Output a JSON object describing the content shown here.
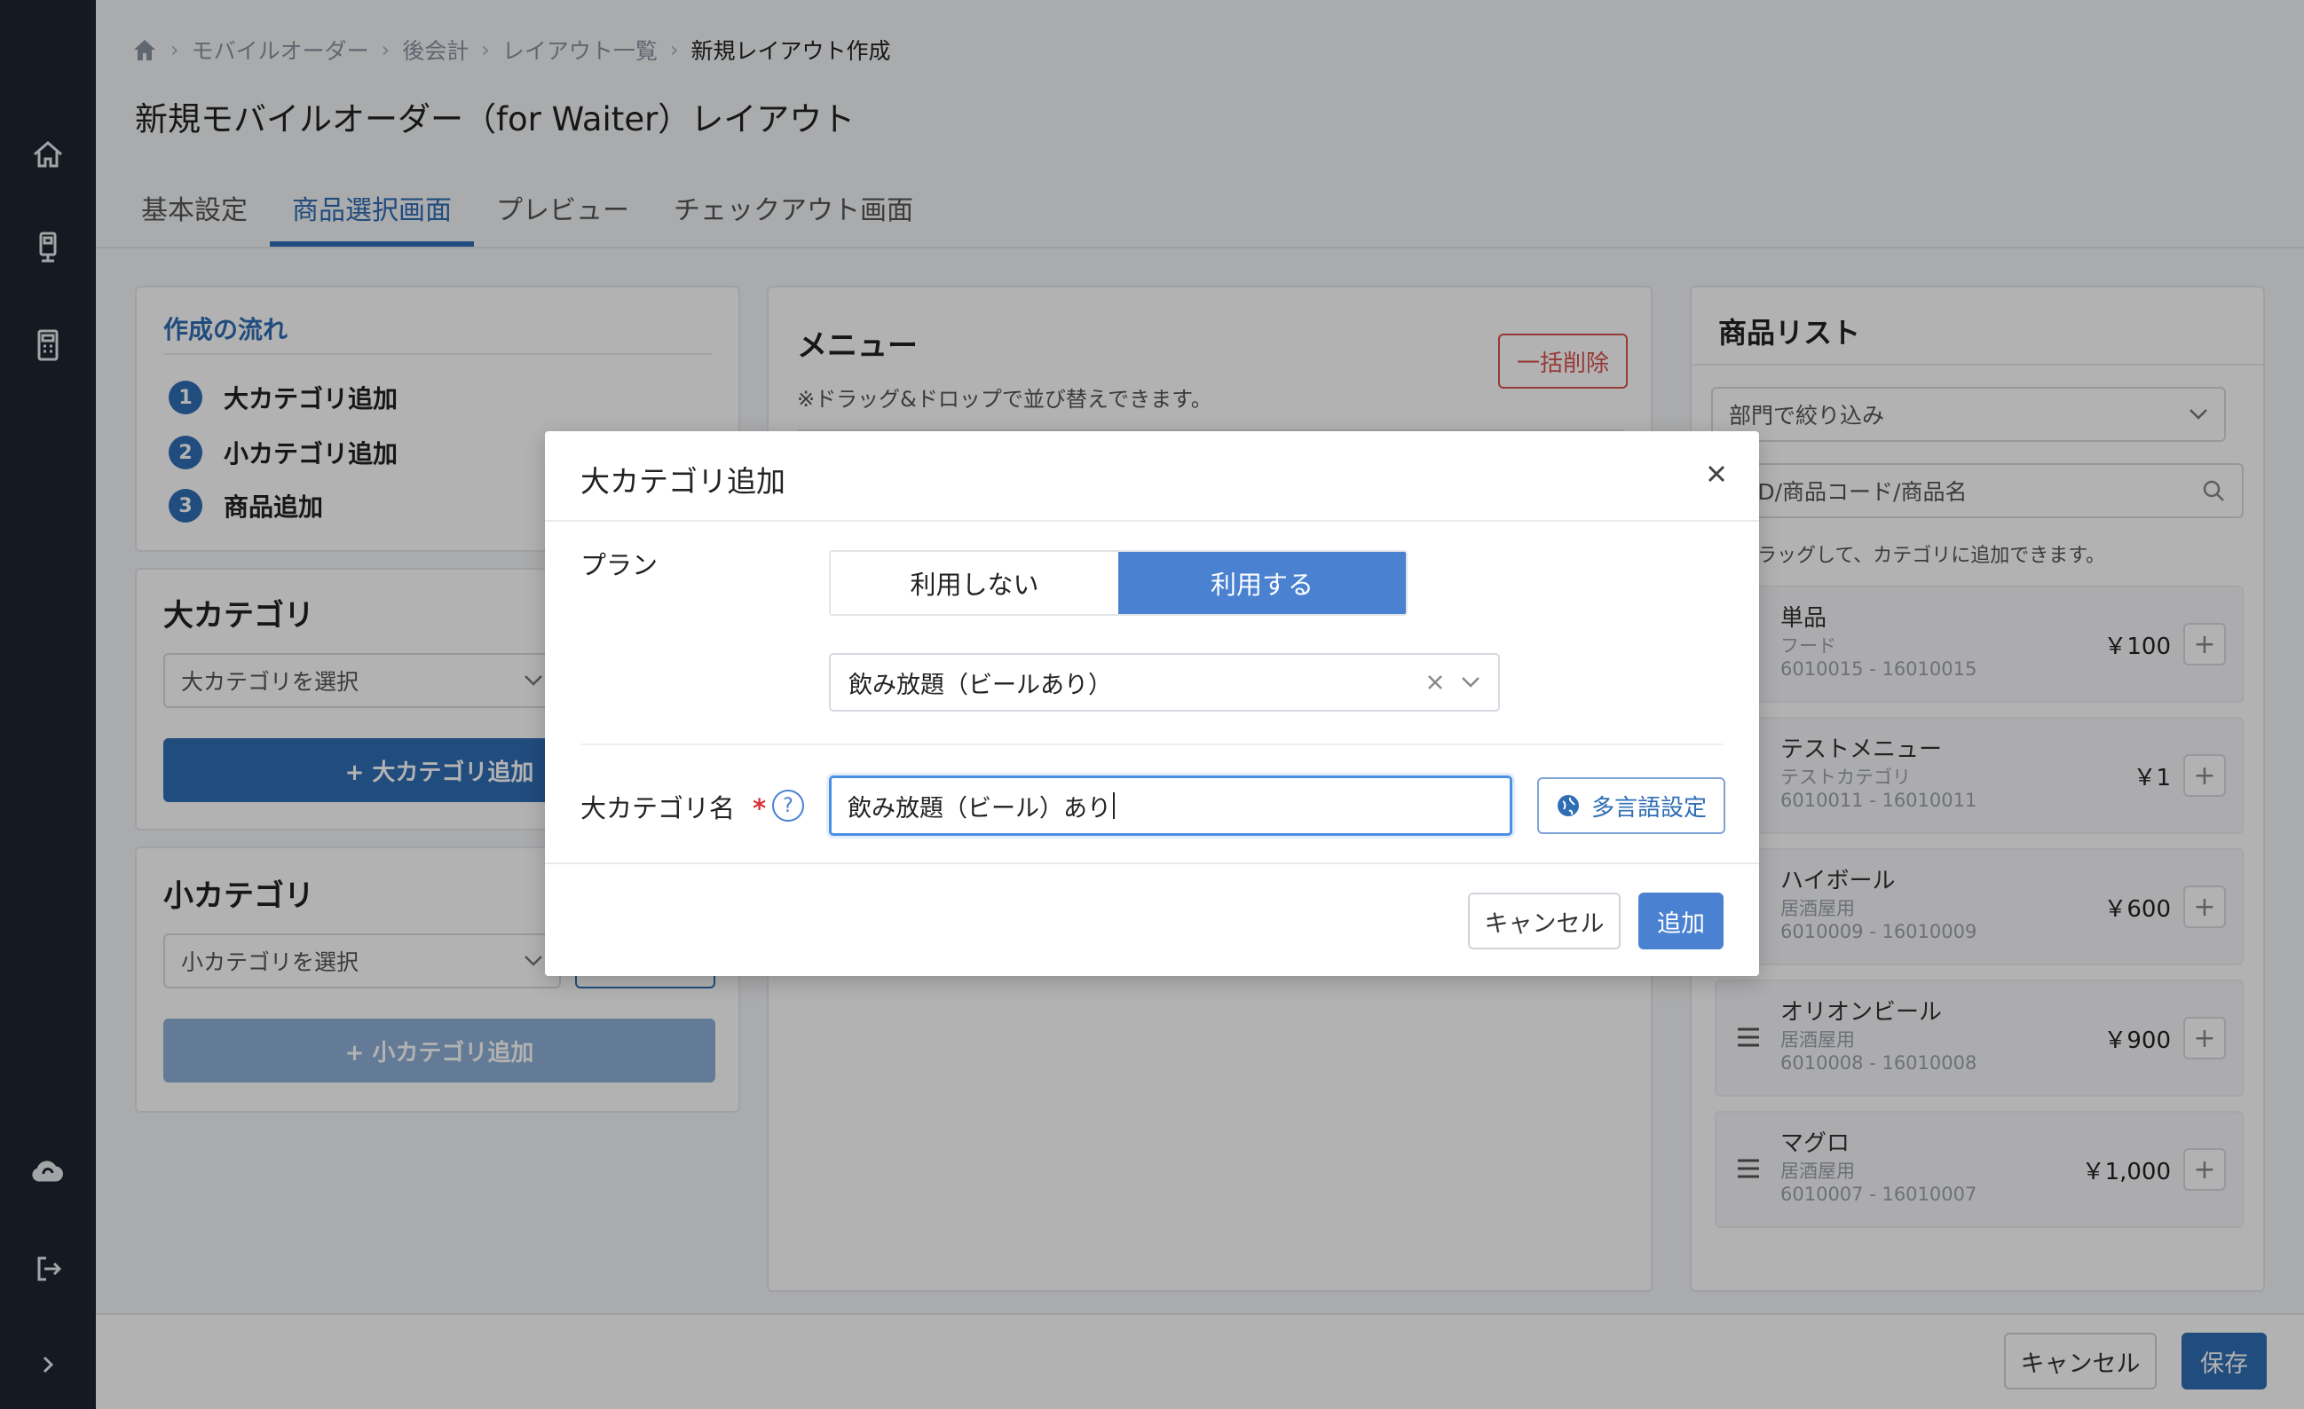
{
  "breadcrumb": [
    "モバイルオーダー",
    "後会計",
    "レイアウト一覧"
  ],
  "breadcrumb_current": "新規レイアウト作成",
  "page_title": "新規モバイルオーダー（for Waiter）レイアウト",
  "tabs": [
    "基本設定",
    "商品選択画面",
    "プレビュー",
    "チェックアウト画面"
  ],
  "flow": {
    "title": "作成の流れ",
    "steps": [
      {
        "num": "1",
        "label": "大カテゴリ追加"
      },
      {
        "num": "2",
        "label": "小カテゴリ追加"
      },
      {
        "num": "3",
        "label": "商品追加"
      }
    ]
  },
  "large_category": {
    "title": "大カテゴリ",
    "placeholder": "大カテゴリを選択",
    "add_button": "+ 大カテゴリ追加"
  },
  "small_category": {
    "title": "小カテゴリ",
    "placeholder": "小カテゴリを選択",
    "add_button": "+ 小カテゴリ追加"
  },
  "menu": {
    "title": "メニュー",
    "note": "※ドラッグ&ドロップで並び替えできます。",
    "bulk_delete": "一括削除"
  },
  "products": {
    "title": "商品リスト",
    "filter_placeholder": "部門で絞り込み",
    "search_placeholder": "品ID/商品コード/商品名",
    "note": "をドラッグして、カテゴリに追加できます。",
    "items": [
      {
        "name": "単品",
        "category": "フード",
        "code": "6010015 - 16010015",
        "price": "￥100"
      },
      {
        "name": "テストメニュー",
        "category": "テストカテゴリ",
        "code": "6010011 - 16010011",
        "price": "￥1"
      },
      {
        "name": "ハイボール",
        "category": "居酒屋用",
        "code": "6010009 - 16010009",
        "price": "￥600"
      },
      {
        "name": "オリオンビール",
        "category": "居酒屋用",
        "code": "6010008 - 16010008",
        "price": "￥900"
      },
      {
        "name": "マグロ",
        "category": "居酒屋用",
        "code": "6010007 - 16010007",
        "price": "￥1,000"
      }
    ]
  },
  "footer": {
    "cancel": "キャンセル",
    "save": "保存"
  },
  "modal": {
    "title": "大カテゴリ追加",
    "plan_label": "プラン",
    "plan_options": {
      "off": "利用しない",
      "on": "利用する"
    },
    "plan_selected": "飲み放題（ビールあり）",
    "name_label": "大カテゴリ名",
    "required_mark": "*",
    "help": "?",
    "name_value": "飲み放題（ビール）あり",
    "lang_button": "多言語設定",
    "cancel": "キャンセル",
    "add": "追加"
  },
  "colors": {
    "primary": "#2f6db5",
    "accent": "#4a81d1",
    "sidebar": "#1d2631",
    "danger": "#d9534f"
  }
}
